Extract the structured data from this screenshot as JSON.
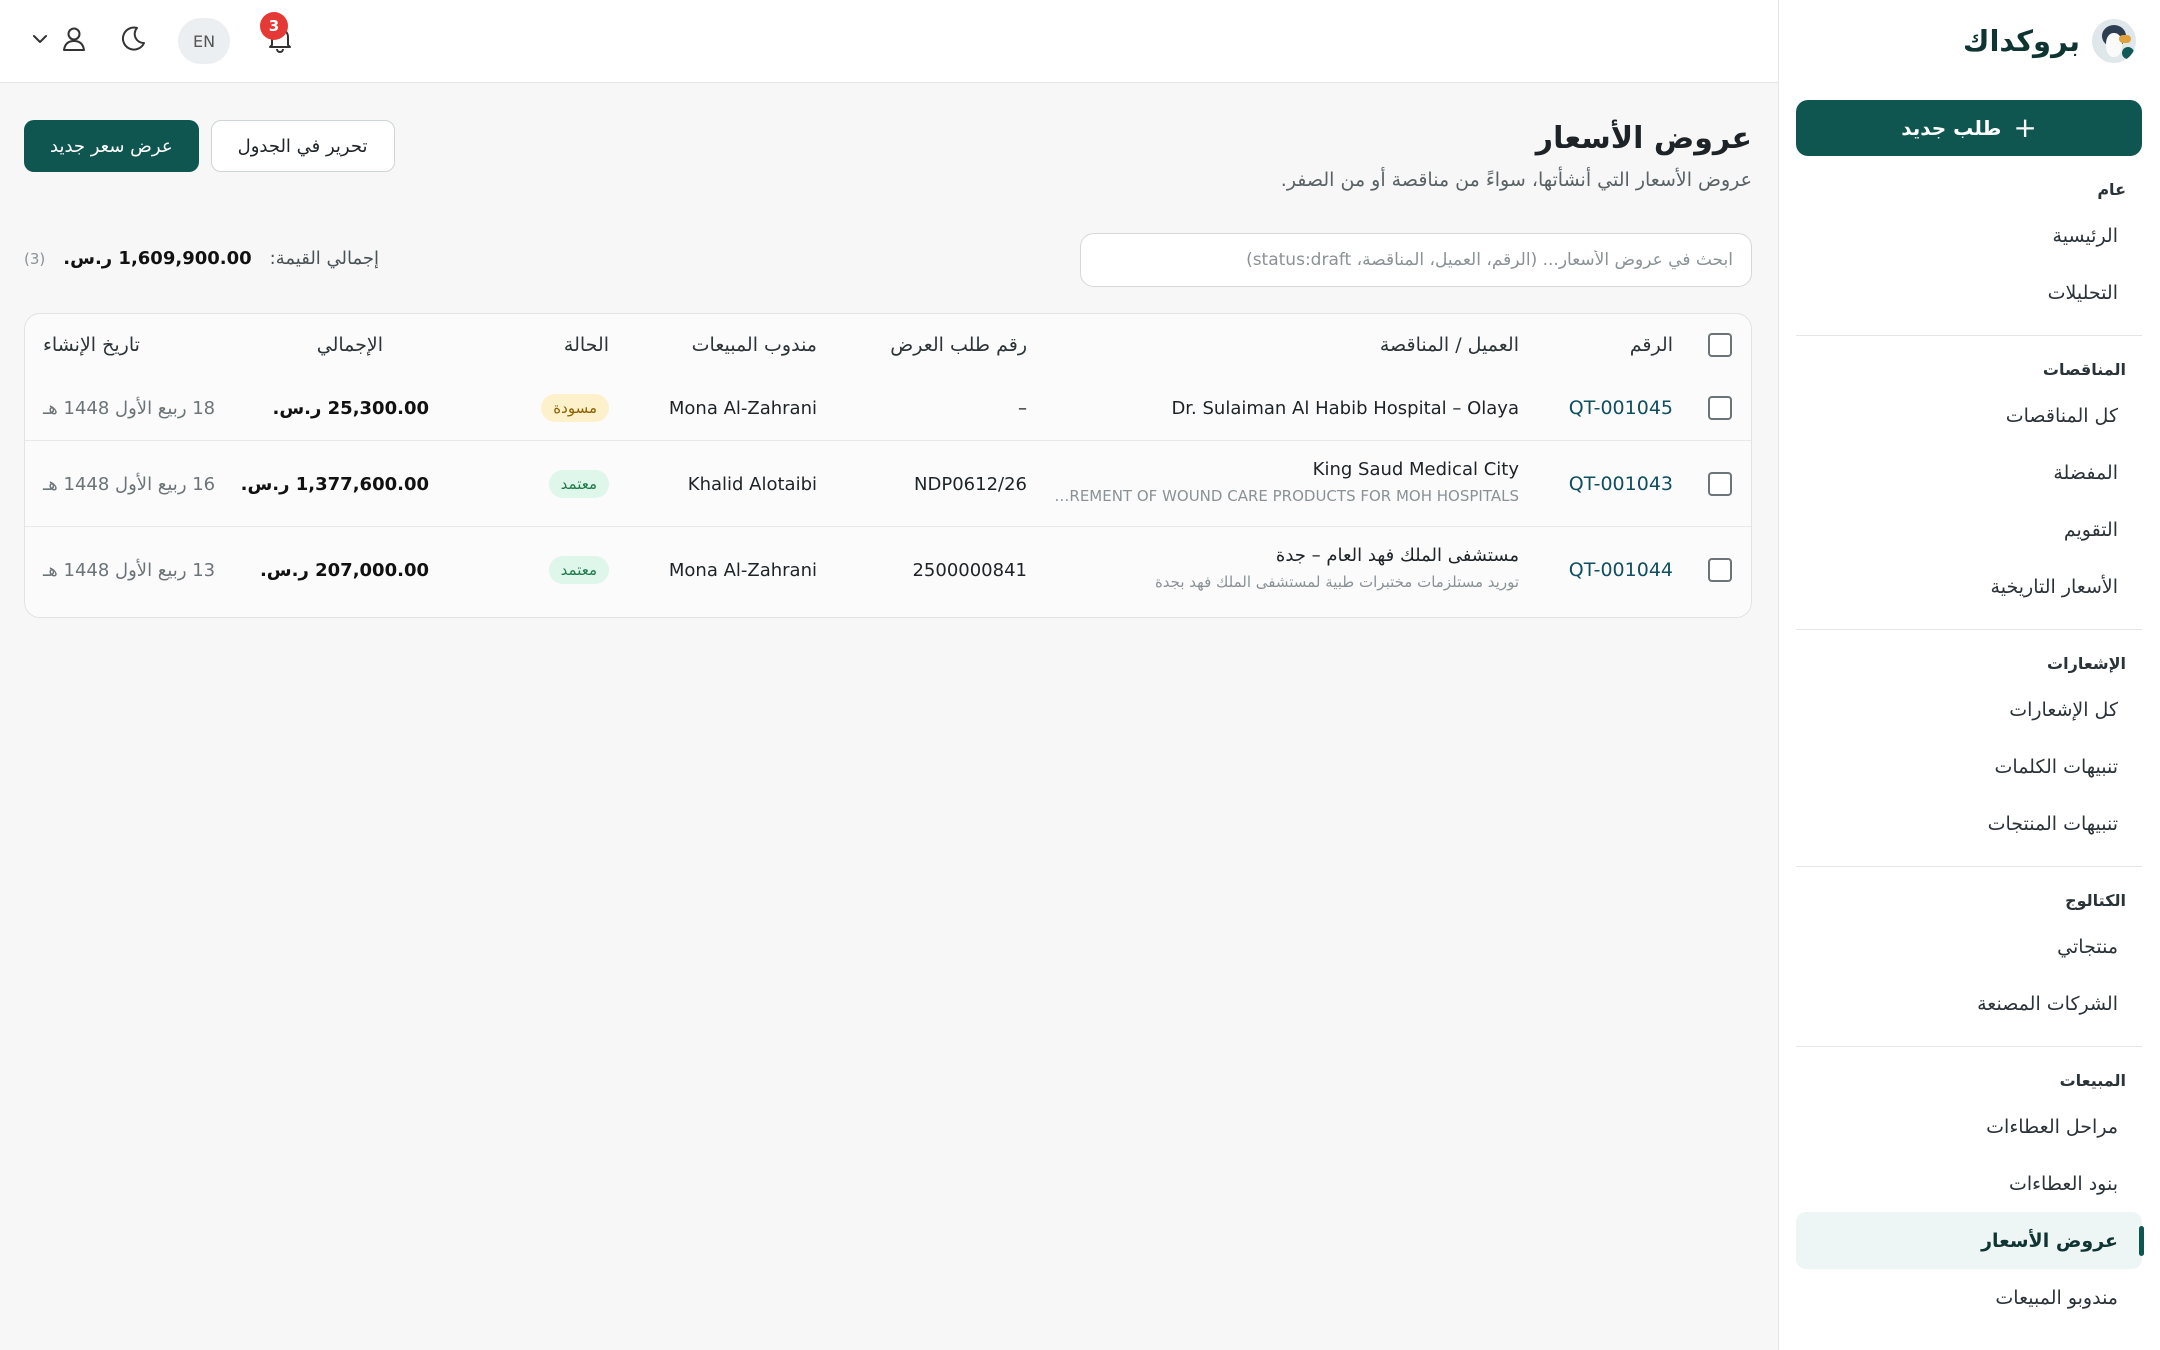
{
  "brand": {
    "name": "بروكداك"
  },
  "sidebar": {
    "new_button": "طلب جديد",
    "sections": [
      {
        "title": "عام",
        "items": [
          "الرئيسية",
          "التحليلات"
        ]
      },
      {
        "title": "المناقصات",
        "items": [
          "كل المناقصات",
          "المفضلة",
          "التقويم",
          "الأسعار التاريخية"
        ]
      },
      {
        "title": "الإشعارات",
        "items": [
          "كل الإشعارات",
          "تنبيهات الكلمات",
          "تنبيهات المنتجات"
        ]
      },
      {
        "title": "الكتالوج",
        "items": [
          "منتجاتي",
          "الشركات المصنعة"
        ]
      },
      {
        "title": "المبيعات",
        "items": [
          "مراحل العطاءات",
          "بنود العطاءات",
          "عروض الأسعار",
          "مندوبو المبيعات"
        ]
      }
    ],
    "active_item": "عروض الأسعار"
  },
  "topbar": {
    "language": "EN",
    "notifications_count": "3"
  },
  "page": {
    "title": "عروض الأسعار",
    "subtitle": "عروض الأسعار التي أنشأتها، سواءً من مناقصة أو من الصفر.",
    "new_quote_button": "عرض سعر جديد",
    "edit_table_button": "تحرير في الجدول",
    "search_placeholder": "ابحث في عروض الأسعار... (الرقم، العميل، المناقصة، status:draft)",
    "total_label": "إجمالي القيمة:",
    "total_value": "1,609,900.00 ر.س.",
    "total_count": "(3)"
  },
  "table": {
    "headers": {
      "number": "الرقم",
      "client": "العميل / المناقصة",
      "rfq": "رقم طلب العرض",
      "rep": "مندوب المبيعات",
      "status": "الحالة",
      "total": "الإجمالي",
      "created": "تاريخ الإنشاء"
    },
    "rows": [
      {
        "number": "QT-001045",
        "client": "Dr. Sulaiman Al Habib Hospital – Olaya",
        "tender": "",
        "rfq": "–",
        "rep": "Mona Al-Zahrani",
        "status": "مسودة",
        "status_type": "draft",
        "total": "25,300.00 ر.س.",
        "created": "18 ربيع الأول 1448 هـ"
      },
      {
        "number": "QT-001043",
        "client": "King Saud Medical City",
        "tender": "…REMENT OF WOUND CARE PRODUCTS FOR MOH HOSPITALS",
        "rfq": "NDP0612/26",
        "rep": "Khalid Alotaibi",
        "status": "معتمد",
        "status_type": "approved",
        "total": "1,377,600.00 ر.س.",
        "created": "16 ربيع الأول 1448 هـ"
      },
      {
        "number": "QT-001044",
        "client": "مستشفى الملك فهد العام – جدة",
        "tender": "توريد مستلزمات مختبرات طبية لمستشفى الملك فهد بجدة",
        "rfq": "2500000841",
        "rep": "Mona Al-Zahrani",
        "status": "معتمد",
        "status_type": "approved",
        "total": "207,000.00 ر.س.",
        "created": "13 ربيع الأول 1448 هـ"
      }
    ]
  },
  "colors": {
    "accent": "#0f5550",
    "link": "#0f4f60",
    "badge": "#e53935",
    "draft_bg": "#fdf1cc",
    "approved_bg": "#dff6ea"
  },
  "icons": [
    "plus-icon",
    "bell-icon",
    "moon-icon",
    "user-icon",
    "chevron-down-icon"
  ]
}
